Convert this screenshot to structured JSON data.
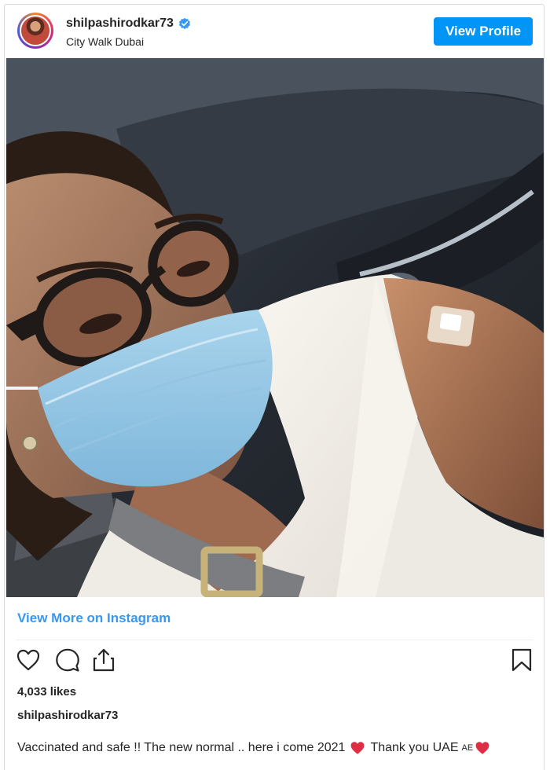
{
  "post": {
    "username": "shilpashirodkar73",
    "location": "City Walk Dubai",
    "view_profile_label": "View Profile",
    "view_more_label": "View More on Instagram",
    "likes": "4,033 likes",
    "caption_username": "shilpashirodkar73",
    "caption_part1": "Vaccinated and safe !! The new normal .. here i come 2021",
    "caption_part2": "Thank you UAE",
    "caption_flag": "AE"
  },
  "icons": {
    "verified": "verified-badge-icon",
    "like": "heart-icon",
    "comment": "comment-icon",
    "share": "share-icon",
    "save": "bookmark-icon",
    "caption_emoji": "red-heart-emoji"
  },
  "colors": {
    "accent": "#0095f6",
    "link": "#3897f0",
    "text": "#262626",
    "heart": "#ed4956"
  }
}
